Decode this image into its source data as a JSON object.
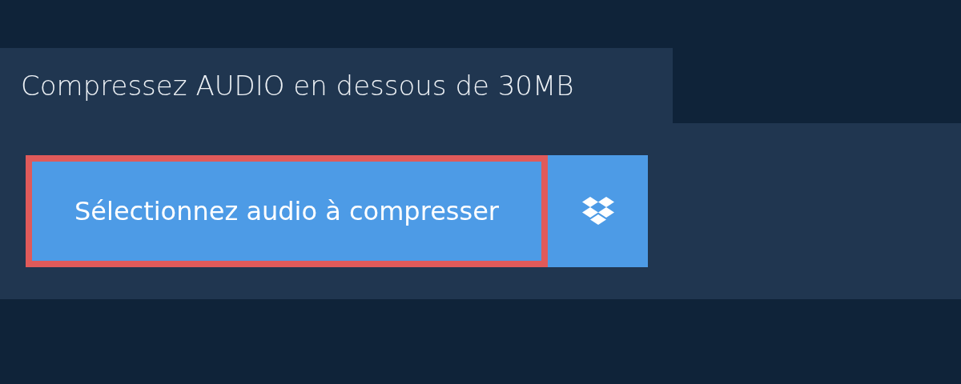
{
  "tab": {
    "title": "Compressez AUDIO en dessous de 30MB"
  },
  "select_button": {
    "label": "Sélectionnez audio à compresser",
    "focused": true
  }
}
